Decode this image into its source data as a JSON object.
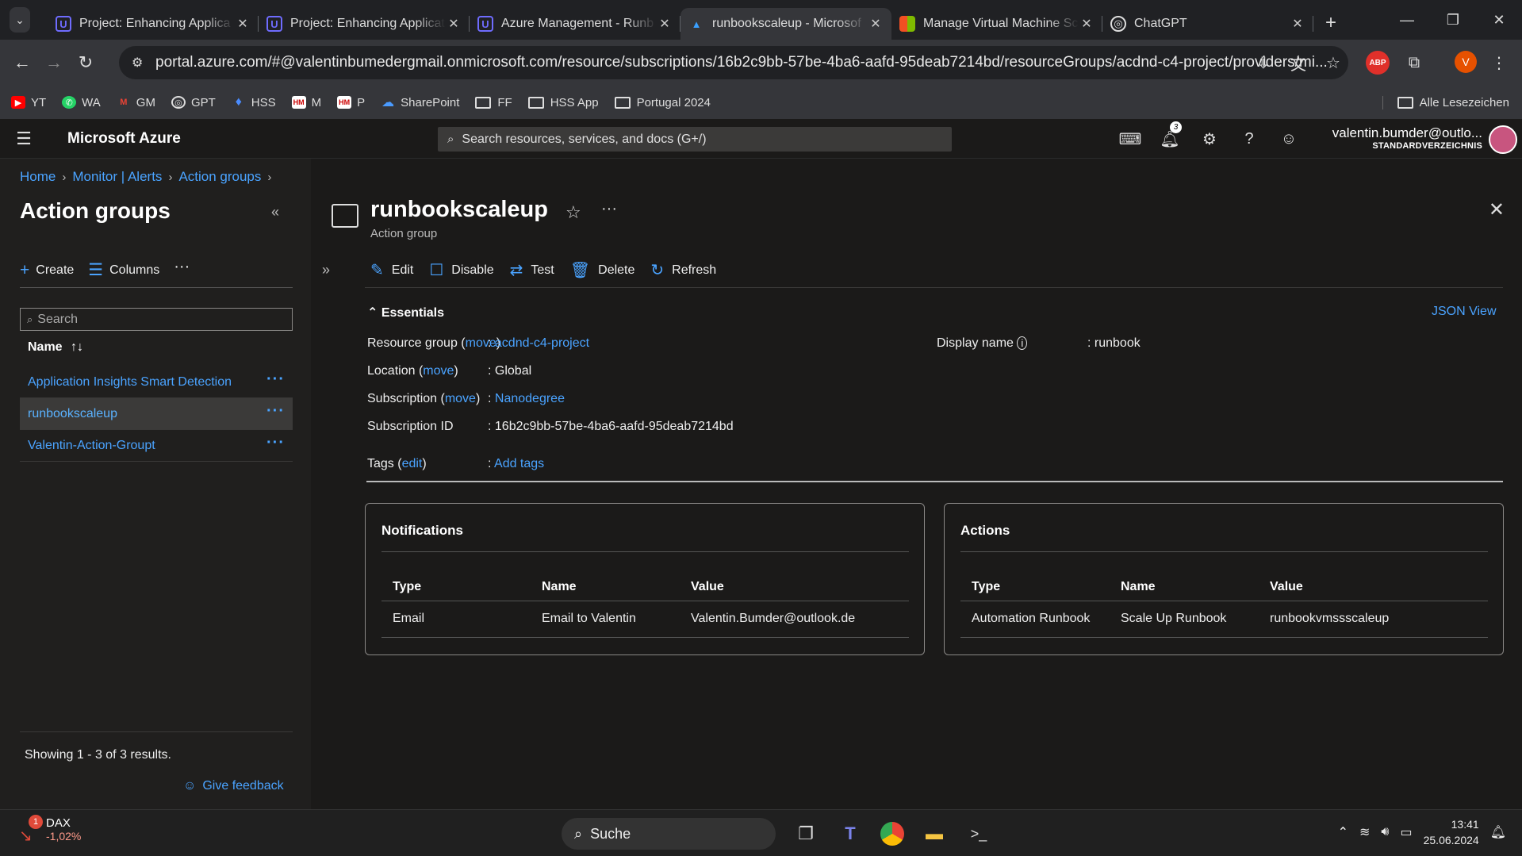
{
  "browser": {
    "tabs": [
      {
        "title": "Project: Enhancing Applica",
        "icon": "udacity-icon",
        "active": false
      },
      {
        "title": "Project: Enhancing Applicat",
        "icon": "udacity-icon",
        "active": false
      },
      {
        "title": "Azure Management - Runb",
        "icon": "udacity-icon",
        "active": false
      },
      {
        "title": "runbookscaleup - Microsof",
        "icon": "azure-icon",
        "active": true
      },
      {
        "title": "Manage Virtual Machine Sc",
        "icon": "microsoft-icon",
        "active": false
      },
      {
        "title": "ChatGPT",
        "icon": "chatgpt-icon",
        "active": false
      }
    ],
    "url": "portal.azure.com/#@valentinbumedergmail.onmicrosoft.com/resource/subscriptions/16b2c9bb-57be-4ba6-aafd-95deab7214bd/resourceGroups/acdnd-c4-project/providers/mi...",
    "profile_initial": "V",
    "ext_label": "ABP",
    "bookmarks": [
      {
        "label": "YT",
        "icon": "youtube-icon"
      },
      {
        "label": "WA",
        "icon": "whatsapp-icon"
      },
      {
        "label": "GM",
        "icon": "gmail-icon"
      },
      {
        "label": "GPT",
        "icon": "chatgpt-icon"
      },
      {
        "label": "HSS",
        "icon": "hss-icon"
      },
      {
        "label": "M",
        "icon": "hm-icon"
      },
      {
        "label": "P",
        "icon": "hm-icon"
      },
      {
        "label": "SharePoint",
        "icon": "sharepoint-icon"
      },
      {
        "label": "FF",
        "icon": "folder-icon"
      },
      {
        "label": "HSS App",
        "icon": "folder-icon"
      },
      {
        "label": "Portugal 2024",
        "icon": "folder-icon"
      }
    ],
    "all_bookmarks": "Alle Lesezeichen"
  },
  "azure": {
    "brand": "Microsoft Azure",
    "search_placeholder": "Search resources, services, and docs (G+/)",
    "notification_count": "3",
    "user_name": "valentin.bumder@outlo...",
    "user_dir": "STANDARDVERZEICHNIS"
  },
  "breadcrumb": [
    "Home",
    "Monitor | Alerts",
    "Action groups"
  ],
  "left": {
    "title": "Action groups",
    "create": "Create",
    "columns": "Columns",
    "search_placeholder": "Search",
    "col_name": "Name",
    "items": [
      {
        "name": "Application Insights Smart Detection",
        "selected": false
      },
      {
        "name": "runbookscaleup",
        "selected": true
      },
      {
        "name": "Valentin-Action-Groupt",
        "selected": false
      }
    ],
    "count": "Showing 1 - 3 of 3 results.",
    "feedback": "Give feedback"
  },
  "resource": {
    "title": "runbookscaleup",
    "subtitle": "Action group",
    "commands": {
      "edit": "Edit",
      "disable": "Disable",
      "test": "Test",
      "delete": "Delete",
      "refresh": "Refresh"
    },
    "essentials": "Essentials",
    "json_view": "JSON View",
    "rg_label": "Resource group",
    "location_label": "Location",
    "sub_label": "Subscription",
    "subid_label": "Subscription ID",
    "tags_label": "Tags",
    "move": "move",
    "edit": "edit",
    "rg_value": "acdnd-c4-project",
    "location_value": "Global",
    "sub_value": "Nanodegree",
    "subid_value": "16b2c9bb-57be-4ba6-aafd-95deab7214bd",
    "tags_value": "Add tags",
    "display_label": "Display name",
    "display_value": "runbook"
  },
  "notifications": {
    "title": "Notifications",
    "headers": [
      "Type",
      "Name",
      "Value"
    ],
    "row": [
      "Email",
      "Email to Valentin",
      "Valentin.Bumder@outlook.de"
    ]
  },
  "actions": {
    "title": "Actions",
    "headers": [
      "Type",
      "Name",
      "Value"
    ],
    "row": [
      "Automation Runbook",
      "Scale Up Runbook",
      "runbookvmssscaleup"
    ]
  },
  "taskbar": {
    "dax_badge": "1",
    "dax_label": "DAX",
    "dax_change": "-1,02%",
    "search": "Suche",
    "time": "13:41",
    "date": "25.06.2024"
  }
}
